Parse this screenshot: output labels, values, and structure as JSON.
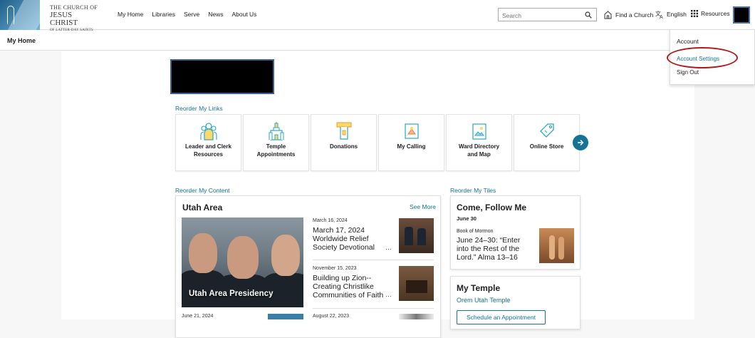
{
  "logo": {
    "line1": "THE CHURCH OF",
    "line2": "JESUS CHRIST",
    "line3": "OF LATTER-DAY SAINTS"
  },
  "nav": [
    "My Home",
    "Libraries",
    "Serve",
    "News",
    "About Us"
  ],
  "search": {
    "placeholder": "Search"
  },
  "tools": {
    "find_church": "Find a Church",
    "language": "English",
    "resources": "Resources"
  },
  "subheader": {
    "title": "My Home"
  },
  "dropdown": {
    "header": "Account",
    "settings": "Account Settings",
    "signout": "Sign Out"
  },
  "links": {
    "reorder_label": "Reorder My Links",
    "tiles": [
      {
        "line1": "Leader and Clerk",
        "line2": "Resources",
        "icon": "leader-clerk-icon"
      },
      {
        "line1": "Temple",
        "line2": "Appointments",
        "icon": "temple-icon"
      },
      {
        "line1": "Donations",
        "line2": "",
        "icon": "donations-icon"
      },
      {
        "line1": "My Calling",
        "line2": "",
        "icon": "calling-icon"
      },
      {
        "line1": "Ward Directory",
        "line2": "and Map",
        "icon": "ward-directory-icon"
      },
      {
        "line1": "Online Store",
        "line2": "",
        "icon": "store-tag-icon"
      }
    ]
  },
  "content": {
    "reorder_label": "Reorder My Content",
    "area_title": "Utah Area",
    "see_more": "See More",
    "feature_caption": "Utah Area Presidency",
    "news": [
      {
        "date": "March 16, 2024",
        "title": "March 17, 2024 Worldwide Relief Society Devotional"
      },
      {
        "date": "November 15, 2023",
        "title": "Building up Zion--Creating Christlike Communities of Faith"
      }
    ],
    "bottom_dates": [
      "June 21, 2024",
      "August 22, 2023"
    ]
  },
  "tiles_col": {
    "reorder_label": "Reorder My Tiles",
    "come_follow": {
      "title": "Come, Follow Me",
      "date": "June 30",
      "book": "Book of Mormon",
      "lesson": "June 24–30: “Enter into the Rest of the Lord.” Alma 13–16"
    },
    "temple": {
      "title": "My Temple",
      "name": "Orem Utah Temple",
      "button": "Schedule an Appointment"
    }
  },
  "colors": {
    "accent": "#157493",
    "highlight": "#b11a1a"
  }
}
